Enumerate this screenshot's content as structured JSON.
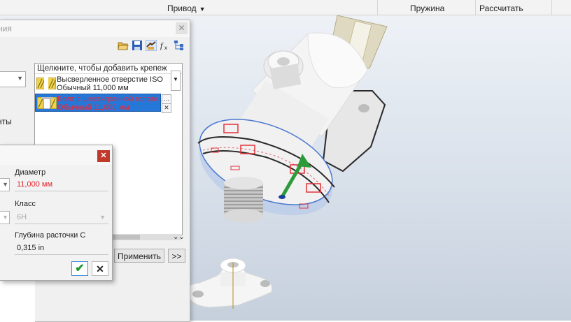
{
  "ribbon": {
    "drive_label": "Привод",
    "spring_label": "Пружина",
    "calculate_label": "Рассчитать"
  },
  "dialog": {
    "title_partial": "ния",
    "left_text_partial": "нты",
    "fastener_list": {
      "header": "Щелкните, чтобы добавить крепеж",
      "items": [
        {
          "line1": "Высверленное отверстие ISO",
          "line2": "Обычный 11,000 мм"
        },
        {
          "line1": "Болт с шестигранной головк...",
          "line2": "Обычный 11,000 мм"
        }
      ],
      "more_button": "...",
      "remove_button": "✕"
    },
    "apply_button": "Применить",
    "expand_button": ">>"
  },
  "popup": {
    "close_button": "✕",
    "diameter_label": "Диаметр",
    "diameter_value": "11,000 мм",
    "class_label": "Класс",
    "class_value": "6H",
    "depth_label": "Глубина расточки C",
    "depth_value": "0,315 in",
    "ok_symbol": "✔",
    "cancel_symbol": "✕"
  },
  "colors": {
    "selection_blue": "#2678d8",
    "error_red": "#e0242e",
    "axis_green": "#2d9b3a",
    "close_red": "#c0392b"
  },
  "icons": [
    "open-folder-icon",
    "save-icon",
    "hands-icon",
    "function-icon",
    "tree-icon",
    "fastener-hole-icon",
    "fastener-bolt-icon",
    "cad-axis-arrow-icon"
  ]
}
